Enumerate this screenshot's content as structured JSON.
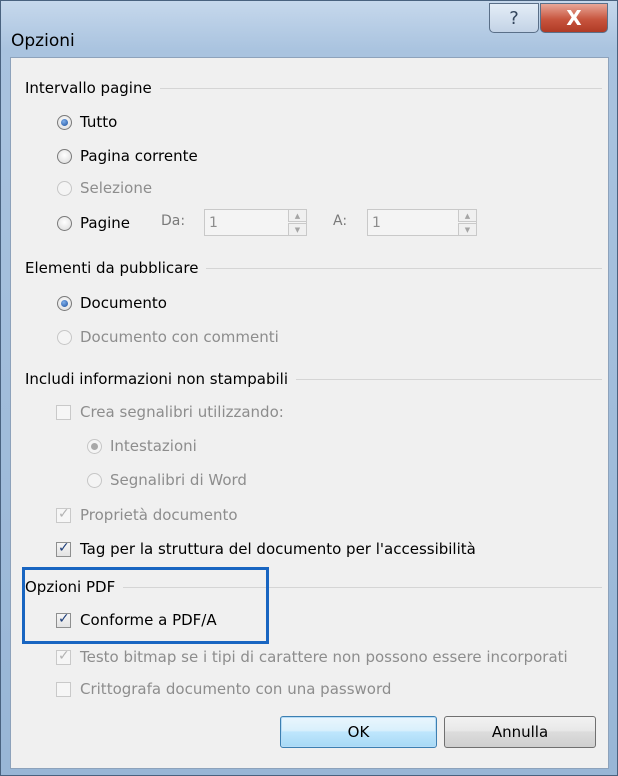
{
  "window": {
    "title": "Opzioni",
    "help_glyph": "?",
    "close_glyph": "X"
  },
  "intervallo": {
    "heading": "Intervallo pagine",
    "tutto": "Tutto",
    "corrente": "Pagina corrente",
    "selezione": "Selezione",
    "pagine": "Pagine",
    "da_label": "Da:",
    "da_value": "1",
    "a_label": "A:",
    "a_value": "1"
  },
  "elementi": {
    "heading": "Elementi da pubblicare",
    "documento": "Documento",
    "documento_commenti": "Documento con commenti"
  },
  "info": {
    "heading": "Includi informazioni non stampabili",
    "segnalibri": "Crea segnalibri utilizzando:",
    "intestazioni": "Intestazioni",
    "segnalibri_word": "Segnalibri di Word",
    "proprieta": "Proprietà documento",
    "tag": "Tag per la struttura del documento per l'accessibilità"
  },
  "pdf": {
    "heading": "Opzioni PDF",
    "conforme": "Conforme a PDF/A",
    "bitmap": "Testo bitmap se i tipi di carattere non possono essere incorporati",
    "crittografa": "Crittografa documento con una password"
  },
  "buttons": {
    "ok": "OK",
    "annulla": "Annulla"
  },
  "colors": {
    "highlight": "#1865c1",
    "radio_selected": "#1c4f9c"
  }
}
